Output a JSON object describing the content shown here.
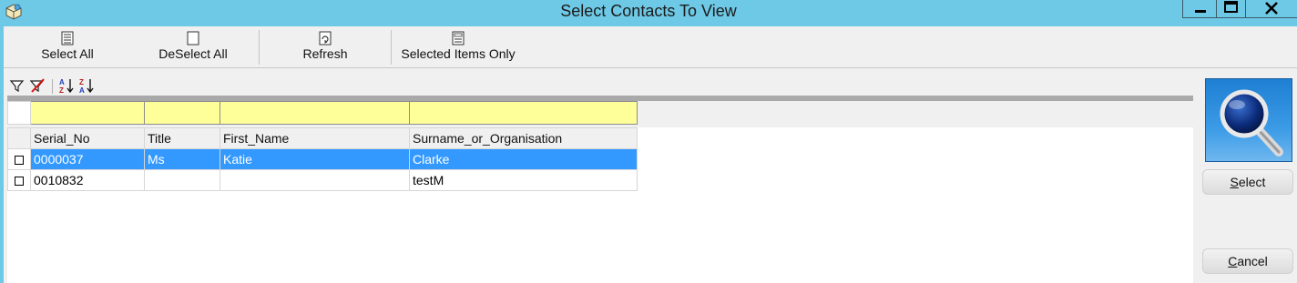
{
  "window": {
    "title": "Select Contacts To View"
  },
  "toolbar": {
    "select_all": "Select All",
    "deselect_all": "DeSelect All",
    "refresh": "Refresh",
    "selected_items_only": "Selected Items Only"
  },
  "grid": {
    "columns": [
      "Serial_No",
      "Title",
      "First_Name",
      "Surname_or_Organisation"
    ],
    "rows": [
      {
        "serial_no": "0000037",
        "title": "Ms",
        "first_name": "Katie",
        "surname": "Clarke",
        "selected": true,
        "checked": false
      },
      {
        "serial_no": "0010832",
        "title": "",
        "first_name": "",
        "surname": "testM",
        "selected": false,
        "checked": false
      }
    ]
  },
  "side_panel": {
    "select_label_first": "S",
    "select_label_rest": "elect",
    "cancel_label_first": "C",
    "cancel_label_rest": "ancel"
  },
  "colors": {
    "titlebar": "#6ec9e6",
    "filter_row": "#ffff99",
    "selection": "#3399ff",
    "search_tile": "#2b8ddc"
  },
  "icons": [
    "app-icon",
    "minimize-icon",
    "maximize-icon",
    "close-icon",
    "select-all-icon",
    "deselect-all-icon",
    "refresh-icon",
    "selected-items-icon",
    "filter-icon",
    "clear-filter-icon",
    "sort-ascending-icon",
    "sort-descending-icon",
    "magnifier-icon"
  ]
}
